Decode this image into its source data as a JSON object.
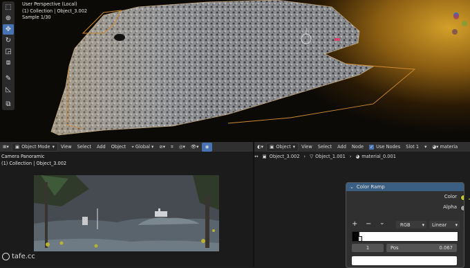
{
  "viewport": {
    "overlay_line1": "User Perspective (Local)",
    "overlay_line2": "(1) Collection | Object_3.002",
    "overlay_line3": "Sample 1/30",
    "tools": [
      "select-box-icon",
      "cursor-icon",
      "move-icon",
      "rotate-icon",
      "scale-icon",
      "transform-icon",
      "annotate-icon",
      "measure-icon",
      "add-cube-icon"
    ]
  },
  "viewport_header": {
    "mode": "Object Mode",
    "menus": [
      "View",
      "Select",
      "Add",
      "Object"
    ],
    "transform": "Global"
  },
  "node_header": {
    "type": "Object",
    "menus": [
      "View",
      "Select",
      "Add",
      "Node"
    ],
    "use_nodes_label": "Use Nodes",
    "use_nodes_checked": true,
    "slot": "Slot 1",
    "material": "materia"
  },
  "breadcrumb": {
    "items": [
      "Object_3.002",
      "Object_1.001",
      "material_0.001"
    ]
  },
  "camera": {
    "title": "Camera Panoramic",
    "subtitle": "(1) Collection | Object_3.002"
  },
  "color_ramp": {
    "title": "Color Ramp",
    "outputs": [
      "Color",
      "Alpha"
    ],
    "color_mode": "RGB",
    "interpolation": "Linear",
    "stop_index": "1",
    "pos_label": "Pos",
    "pos_value": "0.067",
    "add_symbol": "+",
    "remove_symbol": "−",
    "chevron_symbol": "⌄"
  },
  "colors": {
    "accent": "#4772b3",
    "node_header": "#3a5f82",
    "color_socket": "#c7c729",
    "alpha_socket": "#a1a1a1"
  },
  "watermark": {
    "text": "tafe.cc"
  }
}
